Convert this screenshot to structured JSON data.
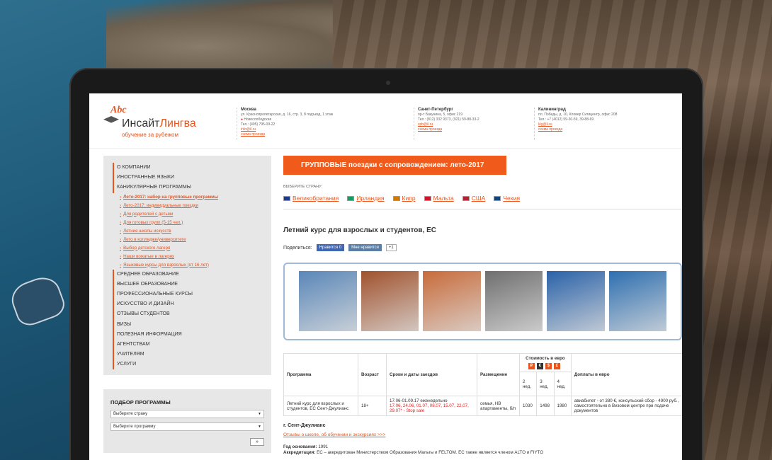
{
  "logo": {
    "abc": "Abc",
    "name_a": "Инсайт",
    "name_b": "Лингва",
    "tagline": "обучение за рубежом"
  },
  "offices": [
    {
      "city": "Москва",
      "address": "ул. Краснопролетарская, д. 16, стр. 3, 8 подъезд, 1 этаж",
      "metro": "Новослободская",
      "phone": "Тел.: (495) 795-09-22",
      "email": "info@il.ru",
      "map": "схема проезда"
    },
    {
      "city": "Санкт-Петербург",
      "address": "пр-т Бакунина, 5, офис 219",
      "phone": "Тел.: (812) 332 9373, (921) 59-88-33-2",
      "email": "spb@il.ru",
      "map": "схема проезда"
    },
    {
      "city": "Калининград",
      "address": "пл. Победы, д. 10, Кловер Ситицентр, офис 208",
      "phone": "Тел.: +7 (4012) 59-30-59, 39-88-69",
      "email": "klg@il.ru",
      "map": "схема проезда"
    }
  ],
  "sidebar": {
    "items": [
      {
        "label": "О КОМПАНИИ",
        "sub": false
      },
      {
        "label": "ИНОСТРАННЫЕ ЯЗЫКИ",
        "sub": false
      },
      {
        "label": "КАНИКУЛЯРНЫЕ ПРОГРАММЫ",
        "sub": false
      },
      {
        "label": "Лето-2017: набор на групповые программы",
        "sub": true,
        "active": true
      },
      {
        "label": "Лето-2017: индивидуальные поездки",
        "sub": true
      },
      {
        "label": "Для родителей с детьми",
        "sub": true
      },
      {
        "label": "Для готовых групп (5-15 чел.)",
        "sub": true
      },
      {
        "label": "Летние школы искусств",
        "sub": true
      },
      {
        "label": "Лето в колледже/университете",
        "sub": true
      },
      {
        "label": "Выбор детского лагеря",
        "sub": true
      },
      {
        "label": "Наши вожатые в лагерях",
        "sub": true
      },
      {
        "label": "Языковые курсы для взрослых (от 16 лет)",
        "sub": true
      },
      {
        "label": "СРЕДНЕЕ ОБРАЗОВАНИЕ",
        "sub": false
      },
      {
        "label": "ВЫСШЕЕ ОБРАЗОВАНИЕ",
        "sub": false
      },
      {
        "label": "ПРОФЕССИОНАЛЬНЫЕ КУРСЫ",
        "sub": false
      },
      {
        "label": "ИСКУССТВО И ДИЗАЙН",
        "sub": false
      },
      {
        "label": "ОТЗЫВЫ СТУДЕНТОВ",
        "sub": false
      },
      {
        "label": "ВИЗЫ",
        "sub": false
      },
      {
        "label": "ПОЛЕЗНАЯ ИНФОРМАЦИЯ",
        "sub": false
      },
      {
        "label": "АГЕНТСТВАМ",
        "sub": false
      },
      {
        "label": "УЧИТЕЛЯМ",
        "sub": false
      },
      {
        "label": "УСЛУГИ",
        "sub": false
      }
    ]
  },
  "picker": {
    "title": "ПОДБОР ПРОГРАММЫ",
    "country": "Выберите страну",
    "program": "Выберите программу",
    "go": "»"
  },
  "main": {
    "banner_bold": "ГРУППОВЫЕ",
    "banner_rest": " поездки с сопровождением: лето-2017",
    "choose_label": "ВЫБЕРИТЕ СТРАНУ:",
    "countries": [
      {
        "name": "Великобритания",
        "flag": "#1f3a8a"
      },
      {
        "name": "Ирландия",
        "flag": "#169b62"
      },
      {
        "name": "Кипр",
        "flag": "#d57800"
      },
      {
        "name": "Мальта",
        "flag": "#cf142b"
      },
      {
        "name": "США",
        "flag": "#b22234"
      },
      {
        "name": "Чехия",
        "flag": "#11457e"
      }
    ],
    "title": "Летний курс для взрослых и студентов, ЕС",
    "share_label": "Поделиться:",
    "fb": "Нравится 0",
    "vk": "Мне нравится",
    "gp": "+1",
    "photos": [
      "#5a87b8",
      "#a0522d",
      "#c86b3a",
      "#6f6f6f",
      "#2a62a8",
      "#2e6fb0"
    ],
    "table": {
      "headers": {
        "program": "Программа",
        "age": "Возраст",
        "dates": "Сроки и даты заездов",
        "housing": "Размещение",
        "price": "Стоимость в евро",
        "extra": "Доплаты в евро"
      },
      "weeks": [
        "2 нед.",
        "3 нед.",
        "4 нед."
      ],
      "row": {
        "program": "Летний курс для взрослых и студентов, ЕС Сент-Джулианс",
        "age": "18+",
        "dates": "17.06-01.09.17 еженедельно",
        "dates_red": "17.06, 24.06, 01.07, 08.07, 15.07, 22.07, 29.07* - Stop sale",
        "housing": "семья, HB апартаменты, б/п",
        "p2": "1030",
        "p3": "1498",
        "p4": "1980",
        "extra": "авиабилет - от 380 €, консульский сбор - 4900 руб., самостоятельно в Визовом центре при подаче документов"
      }
    },
    "city_title": "г. Сент-Джулианс",
    "links": "Отзывы о школе, об обучении и экскурсиях >>>",
    "founded_label": "Год основания:",
    "founded": "1991",
    "accred_label": "Аккредитация:",
    "accred": "ЕС – аккредитован Министерством Образования Мальты и FELTOM. ЕС также является членом ALTO и FIYTO"
  }
}
